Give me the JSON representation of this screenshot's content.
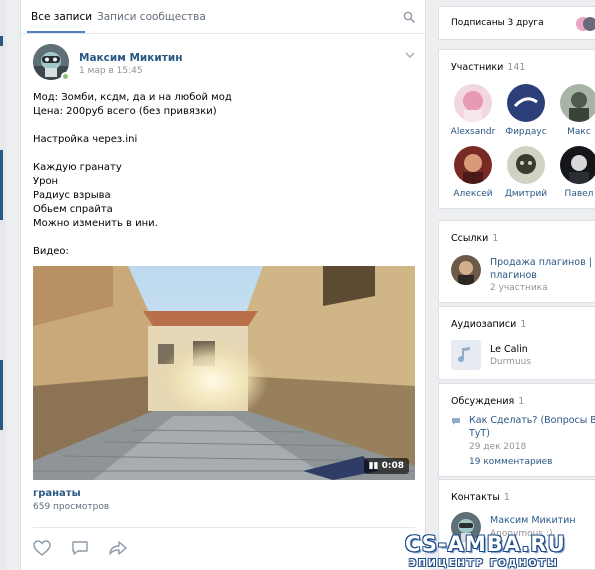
{
  "tabs": {
    "all_posts": "Все записи",
    "community_posts": "Записи сообщества"
  },
  "post": {
    "author": "Максим Микитин",
    "date": "1 мар в 15:45",
    "lines": [
      "Мод: Зомби, ксдм, да и на любой мод",
      "Цена: 200руб всего (без привязки)",
      "",
      "Настройка через.ini",
      "",
      "Каждую гранату",
      "Урон",
      "Радиус взрыва",
      "Обьем спрайта",
      "Можно изменить в ини.",
      "",
      "Видео:"
    ],
    "video_duration": "0:08",
    "video_title": "гранаты",
    "video_views": "659 просмотров"
  },
  "sidebar": {
    "friends": {
      "label": "Подписаны 3 друга"
    },
    "members": {
      "title": "Участники",
      "count": "141",
      "people": [
        "Alexsandr",
        "Фирдаус",
        "Макс",
        "Алексей",
        "Дмитрий",
        "Павел"
      ]
    },
    "links": {
      "title": "Ссылки",
      "count": "1",
      "name_line1": "Продажа плагинов | Зака",
      "name_line2": "плагинов",
      "members": "2 участника"
    },
    "audio": {
      "title": "Аудиозаписи",
      "count": "1",
      "track": "Le Calin",
      "artist": "Durmuus"
    },
    "discussions": {
      "title": "Обсуждения",
      "count": "1",
      "topic_line1": "Как Сделать? (Вопросы Все",
      "topic_line2": "ТуТ)",
      "date": "29 дек 2018",
      "comments": "19 комментариев"
    },
    "contacts": {
      "title": "Контакты",
      "count": "1",
      "name": "Максим Микитин",
      "role": "Anonymous :)"
    }
  },
  "watermark": {
    "main": "CS-AMBA.RU",
    "sub": "ЭПИЦЕНТР ГОДНОТЫ"
  },
  "colors": {
    "link": "#2a5885",
    "accent": "#5181b8",
    "muted": "#939393",
    "background": "#edeef0"
  }
}
